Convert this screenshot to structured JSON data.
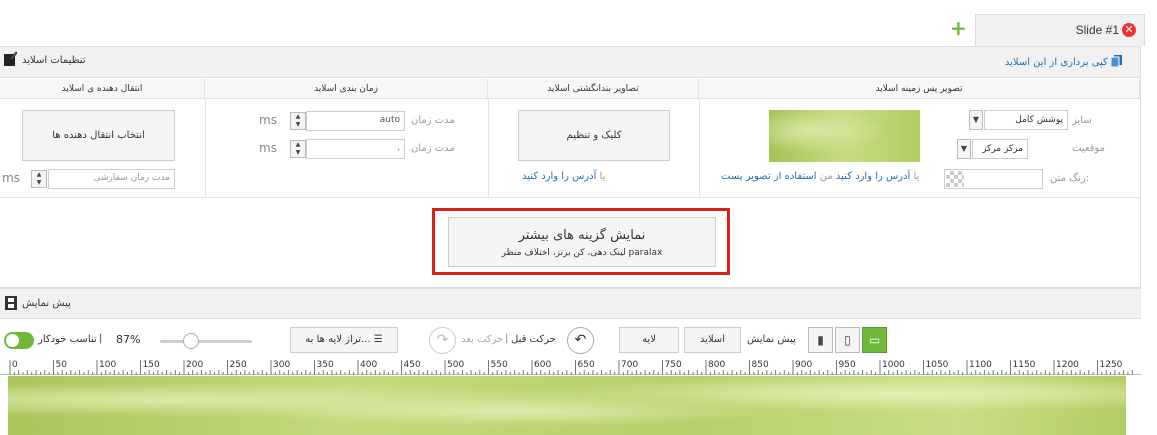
{
  "tabs": {
    "active_label": "Slide #1",
    "add_symbol": "+",
    "close_symbol": "✕"
  },
  "settings": {
    "title": "تنظیمات اسلاید",
    "copy_link": "کپی برداری از این اسلاید"
  },
  "columns": {
    "background": "تصویر پس زمینه اسلاید",
    "thumbnail": "تصاویر بندانگشتی اسلاید",
    "timing": "زمان بندی اسلاید",
    "transition": "انتقال دهنده ی اسلاید"
  },
  "background": {
    "size_label": "سایز",
    "size_value": "پوشش کامل",
    "position_label": "موقعیت",
    "position_value": "مرکز مرکز",
    "text_color_label": "رنگ متن:",
    "link_prefix": "یا",
    "link_enter": "آدرس را وارد کنید",
    "link_or": "من",
    "link_post": "استفاده از تصویر پست"
  },
  "thumbnail": {
    "button": "کلیک و تنظیم",
    "link_prefix": "یا",
    "link": "آدرس را وارد کنید"
  },
  "timing": {
    "label1": "مدت زمان",
    "value1": "auto",
    "label2": "مدت زمان",
    "value2": ".",
    "unit": "ms"
  },
  "transition": {
    "button": "انتخاب انتقال دهنده ها",
    "custom_placeholder": "مدت زمان سفارشی",
    "unit": "ms"
  },
  "more_options": {
    "title": "نمایش گزینه های بیشتر",
    "subtitle": "لینک دهی، کن برنز، اختلاف منظر paralax"
  },
  "preview": {
    "title": "پیش نمایش"
  },
  "toolbar": {
    "preview_label": "پیش نمایش",
    "slide_button": "اسلاید",
    "layer_button": "لایه",
    "undo_label": "حرکت قبل",
    "redo_label": "حرکت بعد",
    "align_button": "تراز لایه ها به...",
    "zoom": "87%",
    "auto_fit": "تناسب خودکار",
    "separator": "|"
  },
  "ruler": {
    "ticks": [
      "0",
      "50",
      "100",
      "150",
      "200",
      "250",
      "300",
      "350",
      "400",
      "450",
      "500",
      "550",
      "600",
      "650",
      "700",
      "750",
      "800",
      "850",
      "900",
      "950",
      "1000",
      "1050",
      "1100",
      "1150",
      "1200",
      "1250"
    ]
  },
  "colors": {
    "accent_green": "#6fb83a",
    "link_blue": "#1e6fb4",
    "highlight_red": "#d9201a",
    "close_red": "#e33333"
  }
}
